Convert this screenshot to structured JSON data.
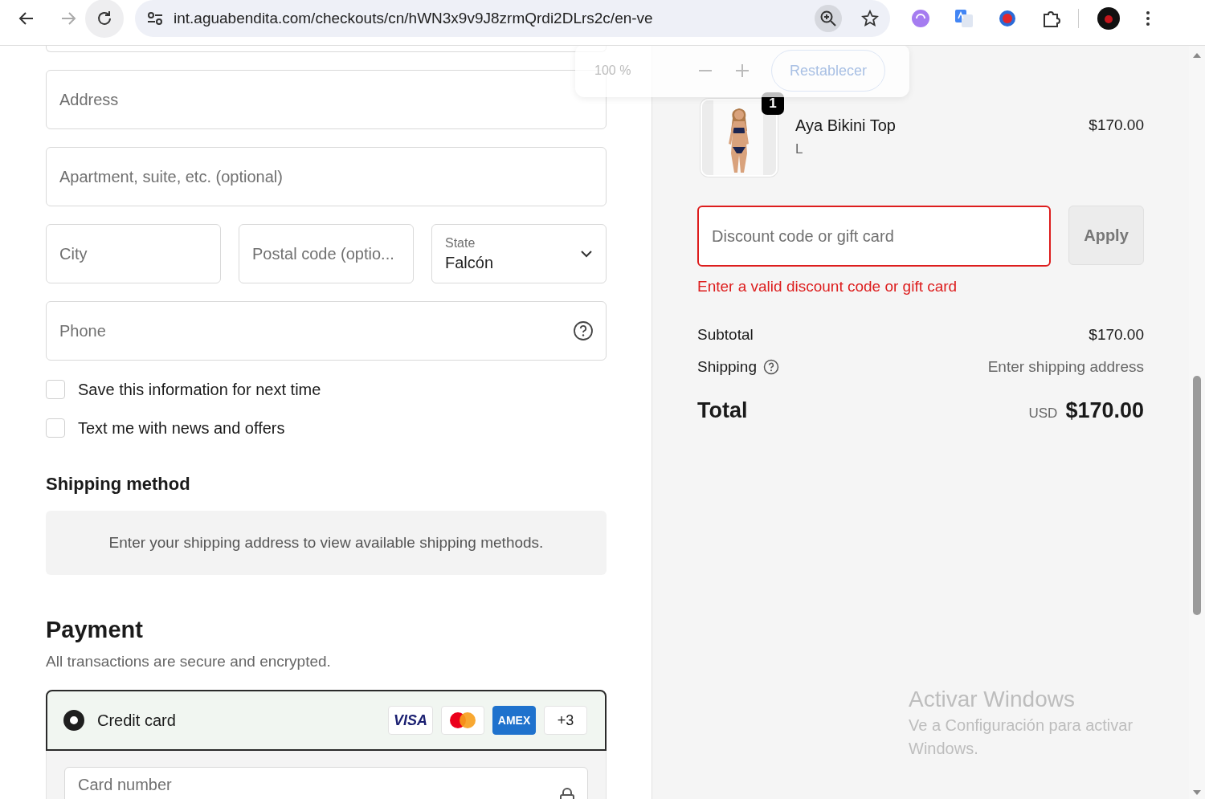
{
  "browser": {
    "url": "int.aguabendita.com/checkouts/cn/hWN3x9v9J8zrmQrdi2DLrs2c/en-ve"
  },
  "zoom_popup": {
    "level": "100 %",
    "reset_label": "Restablecer"
  },
  "contact_form": {
    "fields": [
      {
        "kind": "cut"
      },
      {
        "kind": "text",
        "placeholder": "Address"
      },
      {
        "kind": "text",
        "placeholder": "Apartment, suite, etc. (optional)"
      },
      {
        "kind": "row",
        "children": [
          {
            "kind": "text",
            "placeholder": "City"
          },
          {
            "kind": "text",
            "placeholder": "Postal code (optio..."
          },
          {
            "kind": "select",
            "label": "State",
            "value": "Falcón"
          }
        ]
      },
      {
        "kind": "help",
        "placeholder": "Phone"
      }
    ],
    "checkboxes": [
      {
        "label": "Save this information for next time",
        "checked": false
      },
      {
        "label": "Text me with news and offers",
        "checked": false
      }
    ]
  },
  "shipping_method": {
    "title": "Shipping method",
    "notice": "Enter your shipping address to view available shipping methods."
  },
  "payment": {
    "title": "Payment",
    "subtitle": "All transactions are secure and encrypted.",
    "options": [
      {
        "label": "Credit card",
        "selected": true,
        "brands": [
          {
            "kind": "visa",
            "text": "VISA"
          },
          {
            "kind": "mastercard"
          },
          {
            "kind": "amex",
            "text": "AMEX"
          },
          {
            "kind": "more",
            "text": "+3"
          }
        ]
      }
    ],
    "card_field": {
      "placeholder": "Card number"
    }
  },
  "cart": {
    "items": [
      {
        "quantity": "1",
        "name": "Aya Bikini Top",
        "variant": "L",
        "price": "$170.00"
      }
    ]
  },
  "discount": {
    "placeholder": "Discount code or gift card",
    "error": true,
    "apply": "Apply",
    "error_message": "Enter a valid discount code or gift card"
  },
  "summary": {
    "lines": [
      {
        "kind": "plain",
        "label": "Subtotal",
        "value": "$170.00"
      },
      {
        "kind": "help",
        "label": "Shipping",
        "value": "Enter shipping address"
      }
    ],
    "total": {
      "label": "Total",
      "currency": "USD",
      "amount": "$170.00"
    }
  },
  "system_notice": {
    "title": "Activar Windows",
    "text": "Ve a Configuración para activar Windows."
  }
}
